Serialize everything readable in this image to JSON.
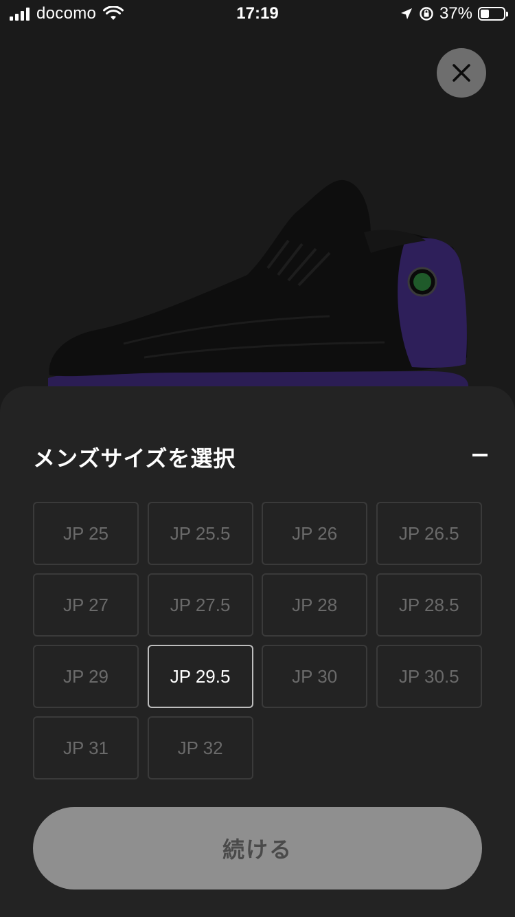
{
  "status_bar": {
    "carrier": "docomo",
    "time": "17:19",
    "battery_percent": "37%",
    "battery_level": 0.37
  },
  "close_button": {
    "icon": "close-icon"
  },
  "product": {
    "image_icon": "sneaker-image",
    "colors": {
      "upper": "#0d0d0d",
      "accent": "#2e1f5a",
      "logo": "#1f5a2a"
    }
  },
  "size_sheet": {
    "title": "メンズサイズを選択",
    "collapse_icon": "minus-icon",
    "sizes": [
      {
        "label": "JP 25",
        "selected": false
      },
      {
        "label": "JP 25.5",
        "selected": false
      },
      {
        "label": "JP 26",
        "selected": false
      },
      {
        "label": "JP 26.5",
        "selected": false
      },
      {
        "label": "JP 27",
        "selected": false
      },
      {
        "label": "JP 27.5",
        "selected": false
      },
      {
        "label": "JP 28",
        "selected": false
      },
      {
        "label": "JP 28.5",
        "selected": false
      },
      {
        "label": "JP 29",
        "selected": false
      },
      {
        "label": "JP 29.5",
        "selected": true
      },
      {
        "label": "JP 30",
        "selected": false
      },
      {
        "label": "JP 30.5",
        "selected": false
      },
      {
        "label": "JP 31",
        "selected": false
      },
      {
        "label": "JP 32",
        "selected": false
      }
    ],
    "continue_label": "続ける"
  }
}
